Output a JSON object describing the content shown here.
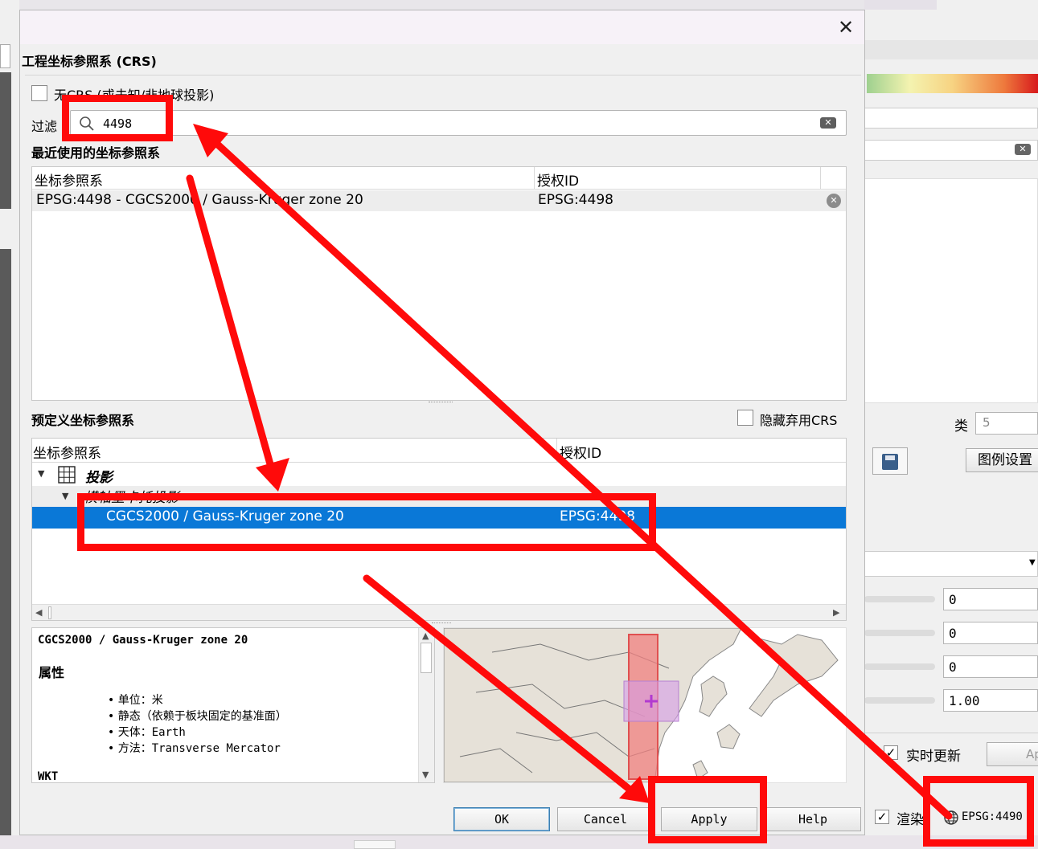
{
  "dialog": {
    "close_glyph": "✕",
    "project_crs_title": "工程坐标参照系 (CRS)",
    "no_crs_label": "无CRS (或未知/非地球投影)",
    "filter_label": "过滤",
    "filter_value": "4498",
    "recent_title": "最近使用的坐标参照系",
    "recent_table": {
      "headers": [
        "坐标参照系",
        "授权ID"
      ],
      "rows": [
        {
          "crs": "EPSG:4498 - CGCS2000 / Gauss-Kruger zone 20",
          "auth_id": "EPSG:4498"
        }
      ]
    },
    "predefined_title": "预定义坐标参照系",
    "hide_deprecated_label": "隐藏弃用CRS",
    "predefined_table": {
      "headers": [
        "坐标参照系",
        "授权ID"
      ],
      "group": "投影",
      "subgroup": "横轴墨卡托投影",
      "selected_row": {
        "crs": "CGCS2000 / Gauss-Kruger zone 20",
        "auth_id": "EPSG:4498"
      }
    },
    "details": {
      "title": "CGCS2000 / Gauss-Kruger zone 20",
      "properties_heading": "属性",
      "properties": [
        "单位：米",
        "静态（依赖于板块固定的基准面）",
        "天体：Earth",
        "方法：Transverse Mercator"
      ],
      "wkt_heading": "WKT"
    },
    "buttons": {
      "ok": "OK",
      "cancel": "Cancel",
      "apply": "Apply",
      "help": "Help"
    }
  },
  "background": {
    "class_label": "类",
    "class_value": "5",
    "legend_settings": "图例设置",
    "spin_values": [
      "0",
      "0",
      "0",
      "1.00"
    ],
    "live_update_label": "实时更新",
    "apply_partial": "App",
    "render_label": "渲染",
    "crs_status": "EPSG:4490"
  },
  "colors": {
    "selection": "#0a78d7",
    "annotation": "#ff0a0a",
    "crs_zone": "#f08080",
    "map_land": "#e6e1d8"
  }
}
